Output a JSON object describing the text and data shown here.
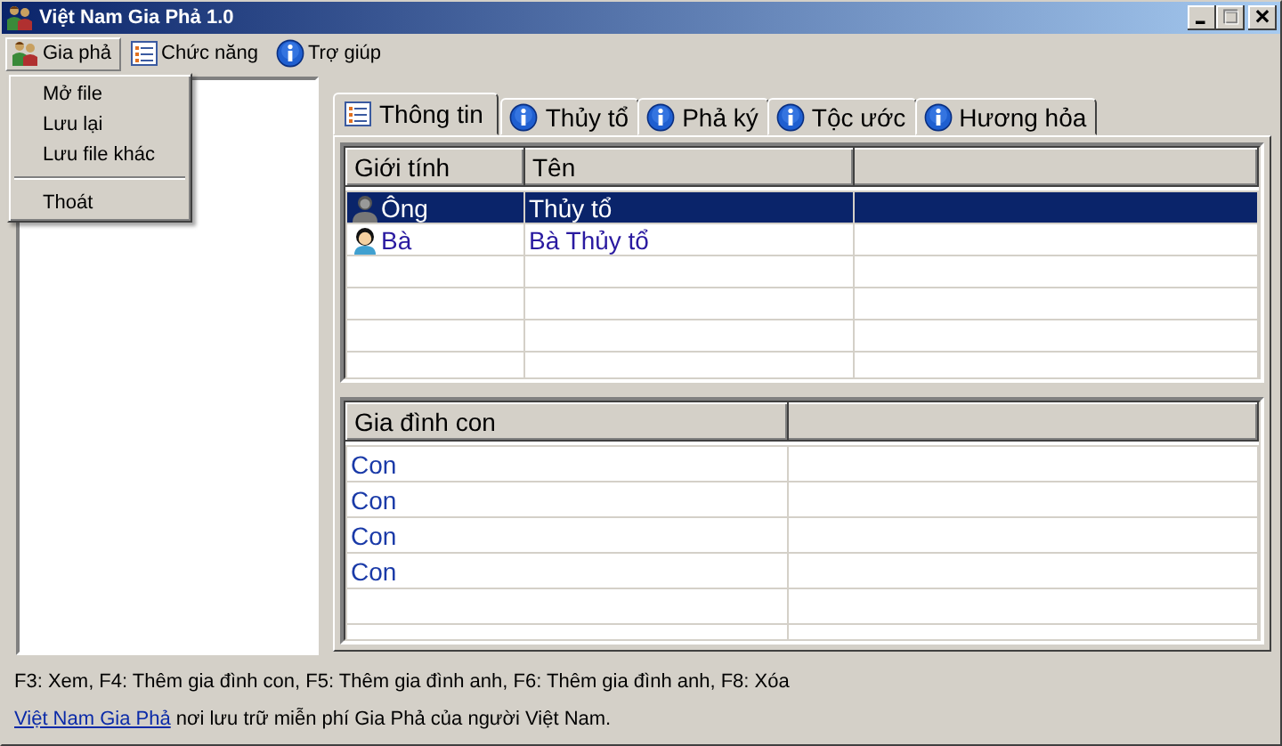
{
  "window": {
    "title": "Việt Nam Gia Phả 1.0"
  },
  "menu_bar": [
    {
      "label": "Gia phả",
      "kind": "family",
      "selected": true
    },
    {
      "label": "Chức năng",
      "kind": "list",
      "selected": false
    },
    {
      "label": "Trợ giúp",
      "kind": "info",
      "selected": false
    }
  ],
  "open_menu": [
    {
      "kind": "item",
      "label": "Mở file"
    },
    {
      "kind": "item",
      "label": "Lưu lại"
    },
    {
      "kind": "item",
      "label": "Lưu file khác"
    },
    {
      "kind": "separator"
    },
    {
      "kind": "item",
      "label": "Thoát"
    }
  ],
  "tabs": [
    {
      "label": "Thông tin",
      "kind": "list",
      "selected": true
    },
    {
      "label": "Thủy tổ",
      "kind": "info",
      "selected": false
    },
    {
      "label": "Phả ký",
      "kind": "info",
      "selected": false
    },
    {
      "label": "Tộc ước",
      "kind": "info",
      "selected": false
    },
    {
      "label": "Hương hỏa",
      "kind": "info",
      "selected": false
    }
  ],
  "members_table": {
    "columns": [
      "Giới tính",
      "Tên"
    ],
    "rows": [
      {
        "kind": "male",
        "gender": "Ông",
        "name": "Thủy tổ",
        "selected": true
      },
      {
        "kind": "female",
        "gender": "Bà",
        "name": "Bà Thủy tổ",
        "selected": false
      }
    ]
  },
  "children_table": {
    "columns": [
      "Gia đình con"
    ],
    "rows": [
      "Con",
      "Con",
      "Con",
      "Con"
    ]
  },
  "status_hint": "F3: Xem, F4: Thêm gia đình con, F5: Thêm gia đình anh, F6: Thêm gia đình anh, F8: Xóa",
  "footer": {
    "link": "Việt Nam Gia Phả",
    "text": "nơi lưu trữ miễn phí Gia Phả của người Việt Nam."
  }
}
